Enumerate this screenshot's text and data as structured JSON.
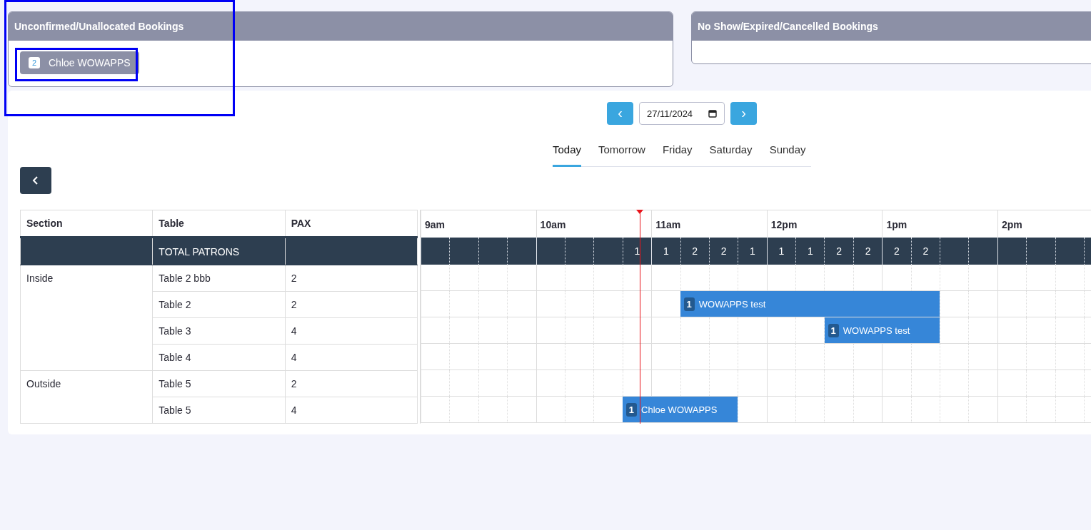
{
  "panels": [
    {
      "title": "Unconfirmed/Unallocated Bookings",
      "bookings": [
        {
          "count": "2",
          "name": "Chloe WOWAPPS"
        }
      ]
    },
    {
      "title": "No Show/Expired/Cancelled Bookings"
    }
  ],
  "date_nav": {
    "prev": "‹",
    "date": "27/11/2024",
    "next": "›"
  },
  "day_tabs": [
    {
      "label": "Today",
      "selected": true
    },
    {
      "label": "Tomorrow",
      "selected": false
    },
    {
      "label": "Friday",
      "selected": false
    },
    {
      "label": "Saturday",
      "selected": false
    },
    {
      "label": "Sunday",
      "selected": false
    }
  ],
  "table": {
    "columns": [
      "Section",
      "Table",
      "PAX"
    ],
    "total_label": "TOTAL PATRONS",
    "sections": [
      {
        "name": "Inside",
        "rows": [
          {
            "table": "Table 2 bbb",
            "pax": "2"
          },
          {
            "table": "Table 2",
            "pax": "2",
            "bookings": [
              {
                "count": "1",
                "name": "WOWAPPS test"
              }
            ]
          },
          {
            "table": "Table 3",
            "pax": "4",
            "bookings": [
              {
                "count": "1",
                "name": "WOWAPPS test"
              }
            ]
          },
          {
            "table": "Table 4",
            "pax": "4"
          }
        ]
      },
      {
        "name": "Outside",
        "rows": [
          {
            "table": "Table 5",
            "pax": "2"
          },
          {
            "table": "Table 5",
            "pax": "4",
            "bookings": [
              {
                "count": "1",
                "name": "Chloe WOWAPPS"
              }
            ]
          }
        ]
      }
    ]
  },
  "timeline": {
    "hours": [
      "9am",
      "10am",
      "11am",
      "12pm",
      "1pm",
      "2pm"
    ],
    "totals": [
      "1",
      "1",
      "2",
      "2",
      "1",
      "1",
      "1",
      "2",
      "2",
      "2",
      "2"
    ]
  }
}
